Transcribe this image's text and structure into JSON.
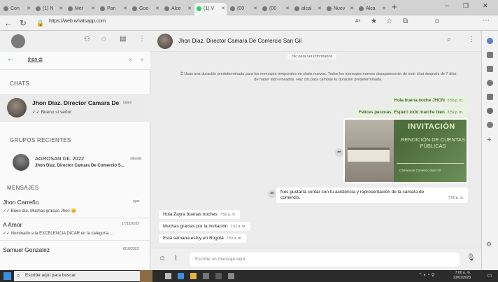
{
  "browser": {
    "tabs": [
      {
        "label": "Con"
      },
      {
        "label": "(1) N"
      },
      {
        "label": "Mer"
      },
      {
        "label": "Pan"
      },
      {
        "label": "Goo"
      },
      {
        "label": "Alce"
      },
      {
        "label": "(1) V"
      },
      {
        "label": "(00"
      },
      {
        "label": "(00"
      },
      {
        "label": "alcal"
      },
      {
        "label": "Nuev"
      },
      {
        "label": "Alca"
      }
    ],
    "url": "https://web.whatsapp.com",
    "reader_label": "Aᵃ"
  },
  "left": {
    "search_value": "jhon di",
    "section_chats": "CHATS",
    "section_groups": "GRUPOS RECIENTES",
    "section_messages": "MENSAJES",
    "chats": [
      {
        "title": "Jhon Diaz. Director Camara De C...",
        "time": "lunes",
        "preview": "✓✓ Bueno sí señor"
      }
    ],
    "groups": [
      {
        "title": "AGROSAN GIL 2022",
        "time": "sábado",
        "preview": "Jhon Diaz. Director Camara De Comercio S..."
      }
    ],
    "messages": [
      {
        "title": "Jhon Carreño",
        "time": "ayer",
        "preview": "✓✓ Buen día. Muchas gracias Jhon 😊"
      },
      {
        "title": "A Amor",
        "time": "17/12/2022",
        "preview": "✓✓ Nominado a la EXCELENCIA DICAR en la categoría ..."
      },
      {
        "title": "Samuel Gonzalez",
        "time": "8/10/2022",
        "preview": ""
      }
    ]
  },
  "conversation": {
    "title": "Jhon Diaz. Director Camara De Comercio San Gil",
    "top_snip": "clic para ver informados",
    "system_notice": "Usas una duración predeterminada para los mensajes temporales en chats nuevos. Todos los mensajes nuevos desaparecerán de este chat después de 7 días de haber sido enviados. Haz clic para cambiar tu duración predeterminada.",
    "out1": {
      "text": "Hola buena noche JHON",
      "time": "5:56 p. m."
    },
    "out2": {
      "text": "Felices pascuas. Espero todo marche bien",
      "time": "5:59 p. m."
    },
    "invite_title": "INVITACIÓN",
    "invite_sub": "RENDICIÓN DE CUENTAS PÚBLICAS",
    "invite_footer": "Cámara de Comercio San Gil",
    "in1_line1": "Nos gustaría contar con tu asistencia y representación de la cámara de",
    "in1_line2": "comercio.",
    "in1_time": "7:00 p. m.",
    "out3": {
      "text": "Hola Zayra buenas noches",
      "time": "7:50 a. m."
    },
    "out4": {
      "text": "Muchas gracias por la invitación",
      "time": "7:51 a. m."
    },
    "out5": {
      "text": "Está semana estoy en Bogotá",
      "time": "7:51 a. m."
    },
    "composer_placeholder": "Escribe un mensaje aquí"
  },
  "taskbar": {
    "search_placeholder": "Escribe aquí para buscar",
    "clock_time": "7:00 a. m.",
    "clock_date": "23/01/2023"
  },
  "colors": {
    "whatsapp_teal": "#00a884",
    "outgoing_bubble": "#e6f4dc",
    "windows_blue": "#1976d2"
  }
}
